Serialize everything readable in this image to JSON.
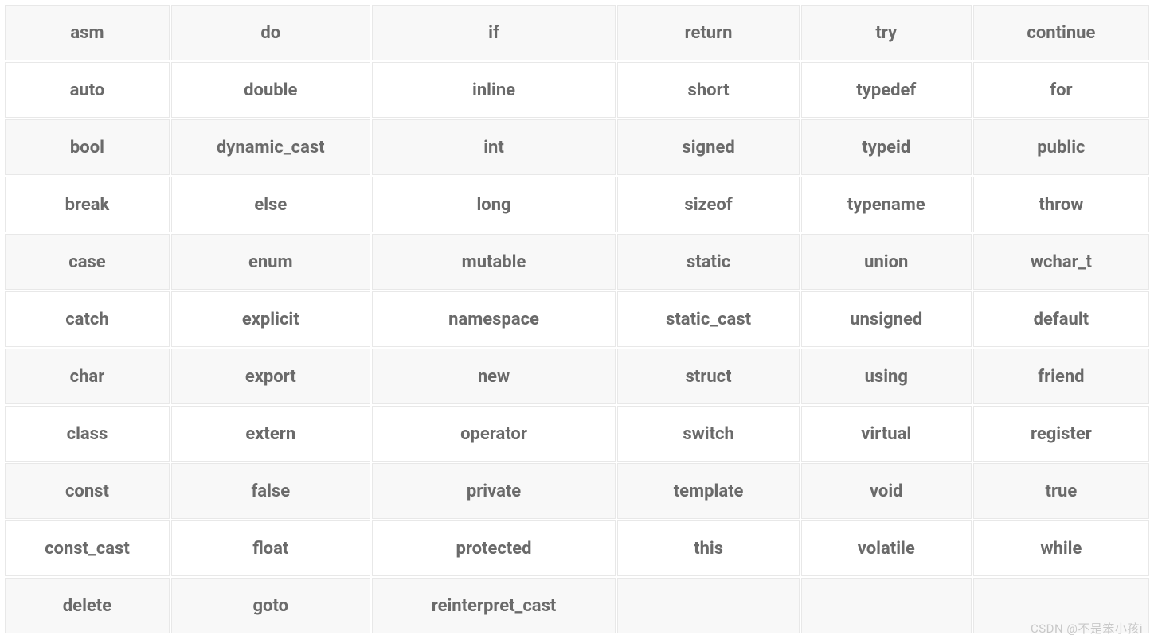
{
  "table": {
    "rows": [
      [
        "asm",
        "do",
        "if",
        "return",
        "try",
        "continue"
      ],
      [
        "auto",
        "double",
        "inline",
        "short",
        "typedef",
        "for"
      ],
      [
        "bool",
        "dynamic_cast",
        "int",
        "signed",
        "typeid",
        "public"
      ],
      [
        "break",
        "else",
        "long",
        "sizeof",
        "typename",
        "throw"
      ],
      [
        "case",
        "enum",
        "mutable",
        "static",
        "union",
        "wchar_t"
      ],
      [
        "catch",
        "explicit",
        "namespace",
        "static_cast",
        "unsigned",
        "default"
      ],
      [
        "char",
        "export",
        "new",
        "struct",
        "using",
        "friend"
      ],
      [
        "class",
        "extern",
        "operator",
        "switch",
        "virtual",
        "register"
      ],
      [
        "const",
        "false",
        "private",
        "template",
        "void",
        "true"
      ],
      [
        "const_cast",
        "float",
        "protected",
        "this",
        "volatile",
        "while"
      ],
      [
        "delete",
        "goto",
        "reinterpret_cast",
        "",
        "",
        ""
      ]
    ]
  },
  "watermark": "CSDN @不是笨小孩i"
}
